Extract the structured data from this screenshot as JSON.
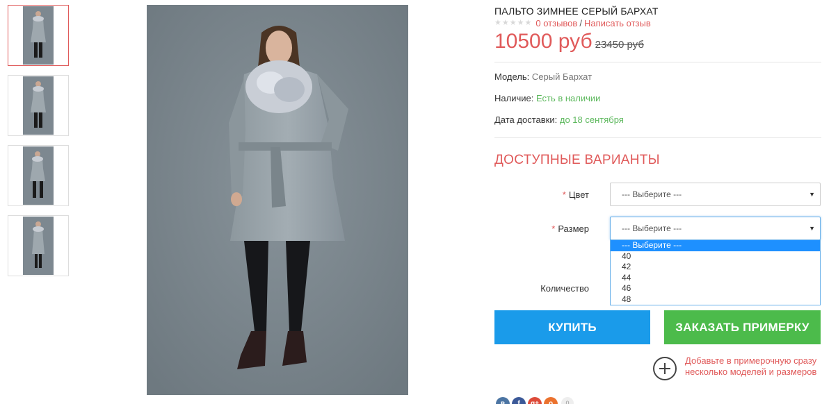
{
  "product": {
    "title": "ПАЛЬТО ЗИМНЕЕ СЕРЫЙ БАРХАТ",
    "rating": 0,
    "reviews_link": "0 отзывов",
    "separator": "/",
    "write_review_link": "Написать отзыв",
    "price": "10500 руб",
    "old_price": "23450 руб",
    "model_label": "Модель:",
    "model_value": "Серый Бархат",
    "stock_label": "Наличие:",
    "stock_value": "Есть в наличии",
    "delivery_label": "Дата доставки:",
    "delivery_value": "до 18 сентября"
  },
  "variants": {
    "title": "ДОСТУПНЫЕ ВАРИАНТЫ",
    "required_mark": "*",
    "color_label": "Цвет",
    "color_value": "--- Выберите ---",
    "size_label": "Размер",
    "size_value": "--- Выберите ---",
    "size_options": [
      "--- Выберите ---",
      "40",
      "42",
      "44",
      "46",
      "48"
    ],
    "quantity_label": "Количество"
  },
  "actions": {
    "buy_label": "КУПИТЬ",
    "fitting_label": "ЗАКАЗАТЬ ПРИМЕРКУ",
    "add_fitting_text": "Добавьте в примерочную сразу несколько моделей и размеров"
  },
  "social": {
    "icons": [
      "vk-icon",
      "facebook-icon",
      "google-plus-icon",
      "odnoklassniki-icon"
    ],
    "letters": [
      "в",
      "f",
      "g+",
      "о"
    ],
    "count": "0"
  },
  "colors": {
    "accent_red": "#e05a5a",
    "buy_blue": "#1a9bea",
    "fitting_green": "#4cbb4b",
    "stock_green": "#5cb85c"
  }
}
